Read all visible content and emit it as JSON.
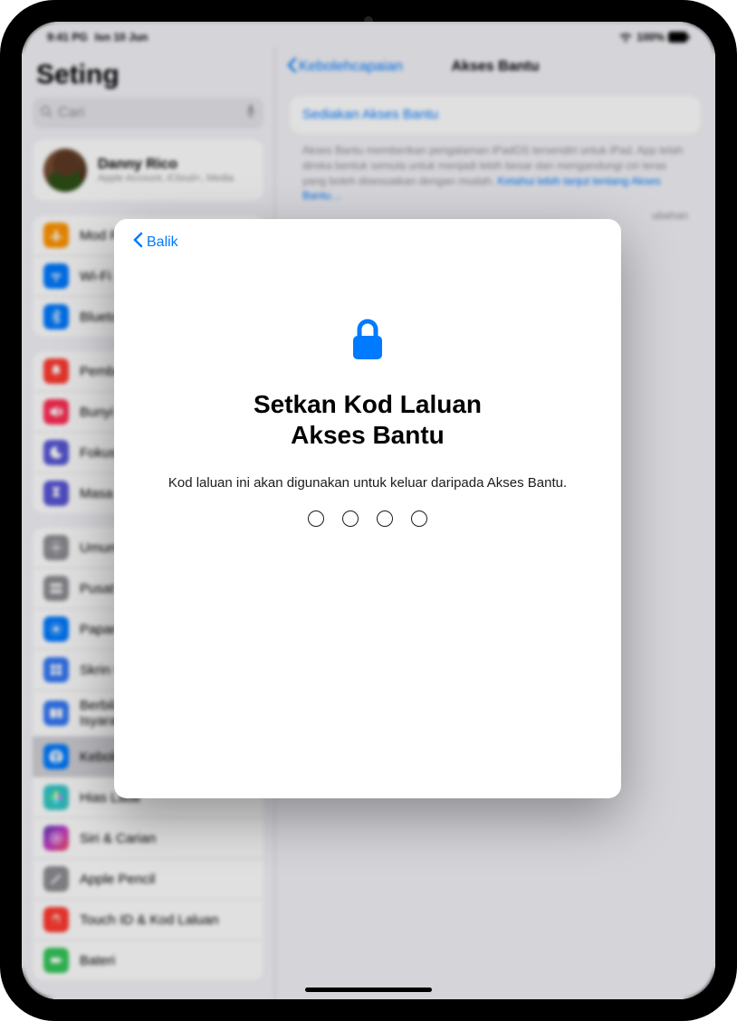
{
  "status": {
    "time": "9:41 PG",
    "date": "Isn 10 Jun",
    "battery": "100%"
  },
  "sidebar": {
    "title": "Seting",
    "search_placeholder": "Cari",
    "profile": {
      "name": "Danny Rico",
      "sub": "Apple Account, iCloud+, Media"
    },
    "group1": [
      {
        "label": "Mod Pesawat",
        "color": "#ff9500",
        "icon": "airplane"
      },
      {
        "label": "Wi-Fi",
        "color": "#007aff",
        "icon": "wifi"
      },
      {
        "label": "Bluetooth",
        "color": "#007aff",
        "icon": "bluetooth"
      }
    ],
    "group2": [
      {
        "label": "Pemberitahuan",
        "color": "#ff3b30",
        "icon": "bell"
      },
      {
        "label": "Bunyi",
        "color": "#ff3b30",
        "icon": "speaker"
      },
      {
        "label": "Fokus",
        "color": "#5856d6",
        "icon": "moon"
      },
      {
        "label": "Masa Skrin",
        "color": "#5856d6",
        "icon": "hourglass"
      }
    ],
    "group3": [
      {
        "label": "Umum",
        "color": "#8e8e93",
        "icon": "gear"
      },
      {
        "label": "Pusat Kawalan",
        "color": "#8e8e93",
        "icon": "switches"
      },
      {
        "label": "Paparan & Kecerahan",
        "color": "#007aff",
        "icon": "sun"
      },
      {
        "label": "Skrin Utama & Dok App",
        "color": "#007aff",
        "icon": "grid"
      },
      {
        "label": "Berbilang Tugas & Gerak Isyarat",
        "color": "#007aff",
        "icon": "multitask"
      },
      {
        "label": "Kebolehcapaian",
        "color": "#007aff",
        "icon": "accessibility",
        "selected": true
      },
      {
        "label": "Hias Latar",
        "color": "#34c8c8",
        "icon": "flower"
      },
      {
        "label": "Siri & Carian",
        "color": "#7b4bd6",
        "icon": "siri"
      },
      {
        "label": "Apple Pencil",
        "color": "#8e8e93",
        "icon": "pencil"
      },
      {
        "label": "Touch ID & Kod Laluan",
        "color": "#ff3b30",
        "icon": "fingerprint"
      },
      {
        "label": "Bateri",
        "color": "#34c759",
        "icon": "battery"
      }
    ]
  },
  "main": {
    "back": "Kebolehcapaian",
    "title": "Akses Bantu",
    "setup_link": "Sediakan Akses Bantu",
    "description": "Akses Bantu memberikan pengalaman iPadOS tersendiri untuk iPad. App telah direka bentuk semula untuk menjadi lebih besar dan mengandungi ciri teras yang boleh disesuaikan dengan mudah.",
    "learn_more": "Ketahui lebih lanjut tentang Akses Bantu…",
    "extra_hint": "ubahan"
  },
  "modal": {
    "back": "Balik",
    "title_line1": "Setkan Kod Laluan",
    "title_line2": "Akses Bantu",
    "description": "Kod laluan ini akan digunakan untuk keluar daripada Akses Bantu."
  }
}
